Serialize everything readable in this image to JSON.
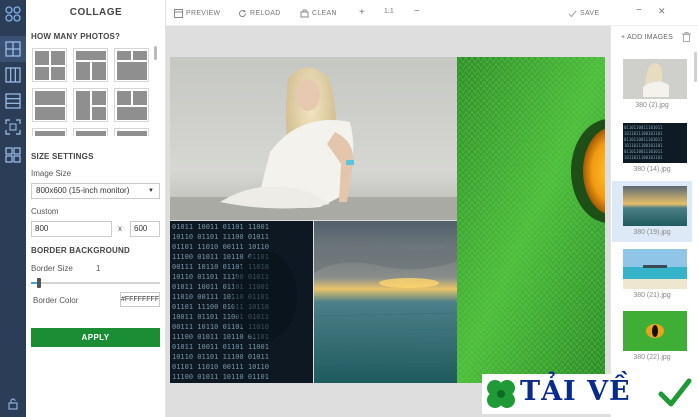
{
  "app": {
    "title": "COLLAGE"
  },
  "toolbar": {
    "preview": "PREVIEW",
    "reload": "RELOAD",
    "clean": "CLEAN",
    "zoom_in": "+",
    "zoom_actual": "1:1",
    "zoom_out": "−",
    "save": "SAVE",
    "minimize": "−",
    "close": "✕"
  },
  "settings": {
    "how_many": "HOW MANY PHOTOS?",
    "size_settings": "SIZE SETTINGS",
    "image_size_label": "Image Size",
    "image_size_value": "800x600 (15-inch monitor)",
    "custom_label": "Custom",
    "width": "800",
    "times": "x",
    "height": "600",
    "border_background": "BORDER BACKGROUND",
    "border_size_label": "Border Size",
    "border_size_value": "1",
    "border_color_label": "Border Color",
    "border_color_value": "#FFFFFFFF",
    "apply": "APPLY"
  },
  "images_panel": {
    "add_images": "+ ADD IMAGES",
    "items": [
      {
        "filename": "380 (2).jpg"
      },
      {
        "filename": "380 (14).jpg"
      },
      {
        "filename": "380 (19).jpg"
      },
      {
        "filename": "380 (21).jpg"
      },
      {
        "filename": "380 (22).jpg"
      }
    ]
  },
  "watermark": {
    "text": "TẢI VỀ"
  },
  "colors": {
    "rail": "#2c3e57",
    "apply_button": "#1b8d34",
    "canvas_bg": "#dedede",
    "selected_thumb": "#dde9f7",
    "watermark_text": "#0a2a8c"
  }
}
